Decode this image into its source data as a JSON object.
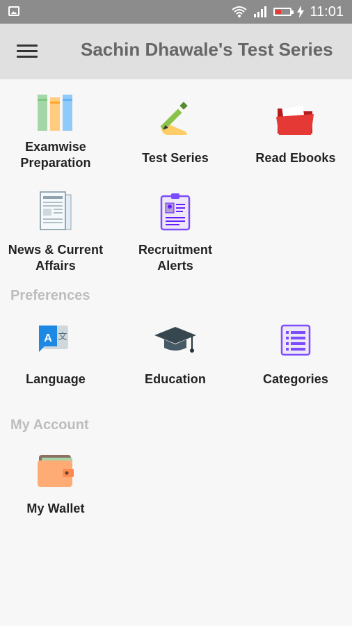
{
  "status_bar": {
    "time": "11:01"
  },
  "app_bar": {
    "title": "Sachin Dhawale's Test Series"
  },
  "main_items": [
    {
      "label_line1": "Examwise",
      "label_line2": "Preparation",
      "icon": "books-icon"
    },
    {
      "label_line1": "Test Series",
      "label_line2": "",
      "icon": "pen-writing-icon"
    },
    {
      "label_line1": "Read Ebooks",
      "label_line2": "",
      "icon": "folder-icon"
    },
    {
      "label_line1": "News & Current",
      "label_line2": "Affairs",
      "icon": "newspaper-icon"
    },
    {
      "label_line1": "Recruitment",
      "label_line2": "Alerts",
      "icon": "id-card-icon"
    }
  ],
  "preferences": {
    "title": "Preferences",
    "items": [
      {
        "label": "Language",
        "icon": "translate-icon"
      },
      {
        "label": "Education",
        "icon": "graduation-cap-icon"
      },
      {
        "label": "Categories",
        "icon": "list-icon"
      }
    ]
  },
  "account": {
    "title": "My Account",
    "items": [
      {
        "label": "My Wallet",
        "icon": "wallet-icon"
      }
    ]
  }
}
